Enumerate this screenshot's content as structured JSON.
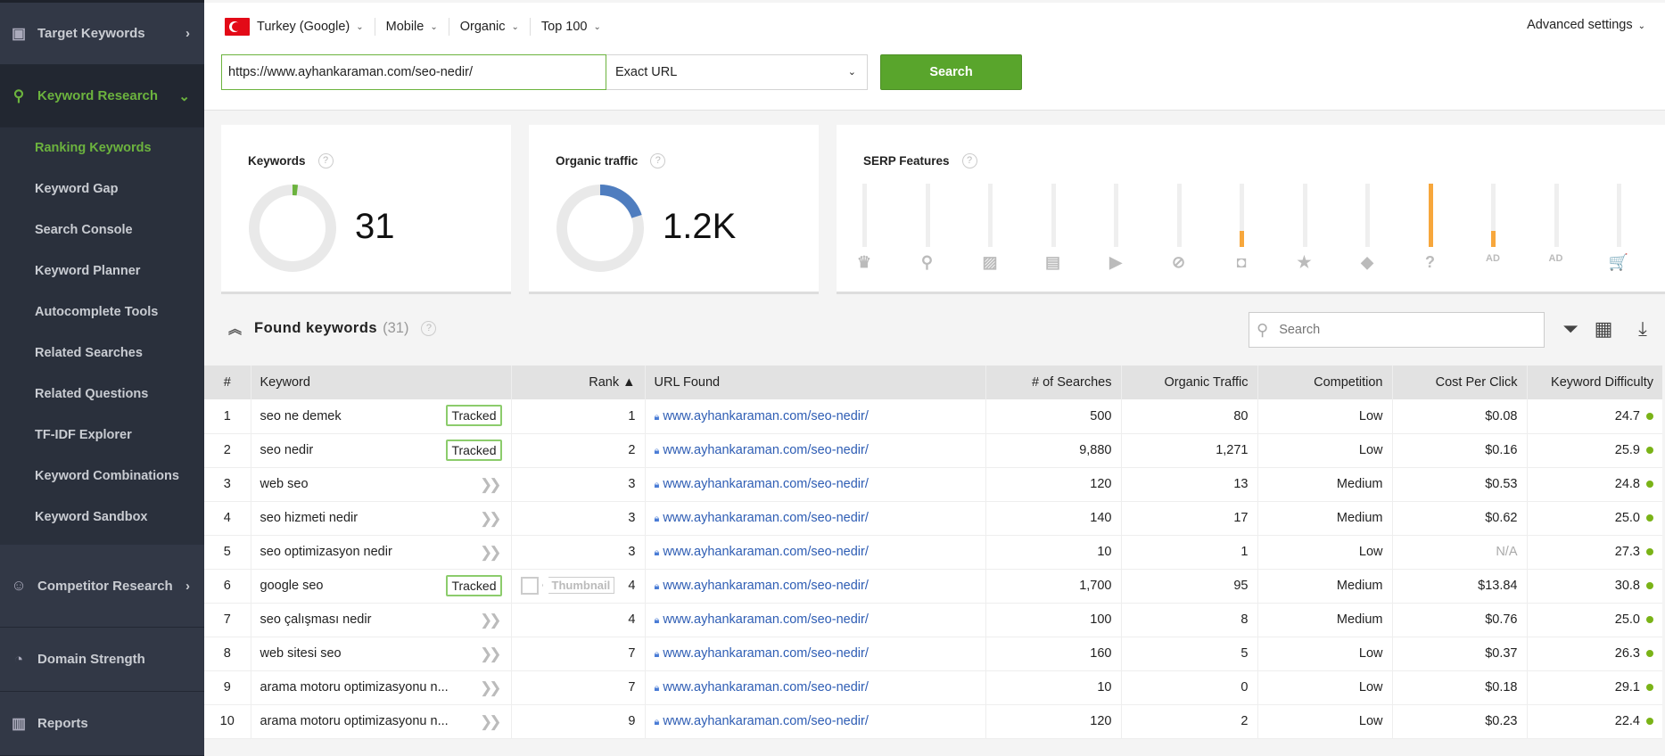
{
  "sidebar": {
    "target_keywords": "Target Keywords",
    "keyword_research": "Keyword Research",
    "sub_items": [
      "Ranking Keywords",
      "Keyword Gap",
      "Search Console",
      "Keyword Planner",
      "Autocomplete Tools",
      "Related Searches",
      "Related Questions",
      "TF-IDF Explorer",
      "Keyword Combinations",
      "Keyword Sandbox"
    ],
    "active_sub": "Ranking Keywords",
    "competitor_research": "Competitor Research",
    "domain_strength": "Domain Strength",
    "reports": "Reports"
  },
  "filters": {
    "country": "Turkey (Google)",
    "device": "Mobile",
    "type": "Organic",
    "depth": "Top 100",
    "advanced": "Advanced settings"
  },
  "search": {
    "url": "https://www.ayhankaraman.com/seo-nedir/",
    "mode": "Exact URL",
    "button": "Search"
  },
  "cards": {
    "keywords": {
      "title": "Keywords",
      "value": "31",
      "fill_fraction": 0.02,
      "color": "#6cb33e"
    },
    "traffic": {
      "title": "Organic traffic",
      "value": "1.2K",
      "fill_fraction": 0.2,
      "color": "#4f7dbf"
    },
    "serp": {
      "title": "SERP Features",
      "features": [
        {
          "icon": "crown-icon",
          "glyph": "♛",
          "level": 0
        },
        {
          "icon": "map-pin-icon",
          "glyph": "⚲",
          "level": 0
        },
        {
          "icon": "image-icon",
          "glyph": "▨",
          "level": 0
        },
        {
          "icon": "news-icon",
          "glyph": "▤",
          "level": 0
        },
        {
          "icon": "video-icon",
          "glyph": "▶",
          "level": 0
        },
        {
          "icon": "link-icon",
          "glyph": "⊘",
          "level": 0
        },
        {
          "icon": "featured-snippet-icon",
          "glyph": "◘",
          "level": 0.25
        },
        {
          "icon": "star-icon",
          "glyph": "★",
          "level": 0
        },
        {
          "icon": "graduation-cap-icon",
          "glyph": "◆",
          "level": 0
        },
        {
          "icon": "question-icon",
          "glyph": "?",
          "level": 1
        },
        {
          "icon": "top-ads-icon",
          "glyph": "AD",
          "level": 0.25
        },
        {
          "icon": "bottom-ads-icon",
          "glyph": "AD",
          "level": 0
        },
        {
          "icon": "cart-icon",
          "glyph": "🛒",
          "level": 0
        }
      ],
      "fill_color": "#f7a73c"
    }
  },
  "found": {
    "title": "Found keywords",
    "count": "(31)",
    "search_placeholder": "Search"
  },
  "table": {
    "headers": [
      "#",
      "Keyword",
      "Rank ▲",
      "URL Found",
      "# of Searches",
      "Organic Traffic",
      "Competition",
      "Cost Per Click",
      "Keyword Difficulty"
    ],
    "tracked_label": "Tracked",
    "thumbnail_label": "Thumbnail",
    "rows": [
      {
        "n": "1",
        "kw": "seo ne demek",
        "tracked": true,
        "rank": "1",
        "url": "www.ayhankaraman.com/seo-nedir/",
        "searches": "500",
        "traffic": "80",
        "comp": "Low",
        "cpc": "$0.08",
        "kd": "24.7"
      },
      {
        "n": "2",
        "kw": "seo nedir",
        "tracked": true,
        "rank": "2",
        "url": "www.ayhankaraman.com/seo-nedir/",
        "searches": "9,880",
        "traffic": "1,271",
        "comp": "Low",
        "cpc": "$0.16",
        "kd": "25.9"
      },
      {
        "n": "3",
        "kw": "web seo",
        "tracked": false,
        "rank": "3",
        "url": "www.ayhankaraman.com/seo-nedir/",
        "searches": "120",
        "traffic": "13",
        "comp": "Medium",
        "cpc": "$0.53",
        "kd": "24.8"
      },
      {
        "n": "4",
        "kw": "seo hizmeti nedir",
        "tracked": false,
        "rank": "3",
        "url": "www.ayhankaraman.com/seo-nedir/",
        "searches": "140",
        "traffic": "17",
        "comp": "Medium",
        "cpc": "$0.62",
        "kd": "25.0"
      },
      {
        "n": "5",
        "kw": "seo optimizasyon nedir",
        "tracked": false,
        "rank": "3",
        "url": "www.ayhankaraman.com/seo-nedir/",
        "searches": "10",
        "traffic": "1",
        "comp": "Low",
        "cpc": "N/A",
        "kd": "27.3"
      },
      {
        "n": "6",
        "kw": "google seo",
        "tracked": true,
        "thumbnail": true,
        "rank": "4",
        "url": "www.ayhankaraman.com/seo-nedir/",
        "searches": "1,700",
        "traffic": "95",
        "comp": "Medium",
        "cpc": "$13.84",
        "kd": "30.8"
      },
      {
        "n": "7",
        "kw": "seo çalışması nedir",
        "tracked": false,
        "rank": "4",
        "url": "www.ayhankaraman.com/seo-nedir/",
        "searches": "100",
        "traffic": "8",
        "comp": "Medium",
        "cpc": "$0.76",
        "kd": "25.0"
      },
      {
        "n": "8",
        "kw": "web sitesi seo",
        "tracked": false,
        "rank": "7",
        "url": "www.ayhankaraman.com/seo-nedir/",
        "searches": "160",
        "traffic": "5",
        "comp": "Low",
        "cpc": "$0.37",
        "kd": "26.3"
      },
      {
        "n": "9",
        "kw": "arama motoru optimizasyonu n...",
        "tracked": false,
        "rank": "7",
        "url": "www.ayhankaraman.com/seo-nedir/",
        "searches": "10",
        "traffic": "0",
        "comp": "Low",
        "cpc": "$0.18",
        "kd": "29.1"
      },
      {
        "n": "10",
        "kw": "arama motoru optimizasyonu n...",
        "tracked": false,
        "rank": "9",
        "url": "www.ayhankaraman.com/seo-nedir/",
        "searches": "120",
        "traffic": "2",
        "comp": "Low",
        "cpc": "$0.23",
        "kd": "22.4"
      }
    ]
  }
}
